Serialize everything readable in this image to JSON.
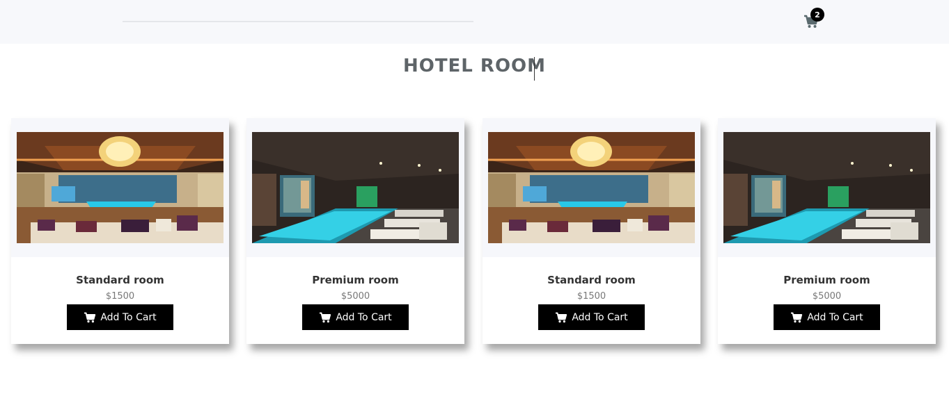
{
  "header": {
    "cart_count": "2"
  },
  "page_title": "HOTEL ROOM",
  "rooms": [
    {
      "name": "Standard room",
      "price": "$1500",
      "button": "Add To Cart",
      "image": "standard-room-photo"
    },
    {
      "name": "Premium room",
      "price": "$5000",
      "button": "Add To Cart",
      "image": "premium-room-photo"
    },
    {
      "name": "Standard room",
      "price": "$1500",
      "button": "Add To Cart",
      "image": "standard-room-photo"
    },
    {
      "name": "Premium room",
      "price": "$5000",
      "button": "Add To Cart",
      "image": "premium-room-photo"
    }
  ],
  "icons": {
    "cart": "cart-icon",
    "button_cart": "cart-icon"
  },
  "colors": {
    "topbar_bg": "#f7f8fb",
    "title": "#5e6468",
    "button_bg": "#000000",
    "button_text": "#ffffff"
  }
}
